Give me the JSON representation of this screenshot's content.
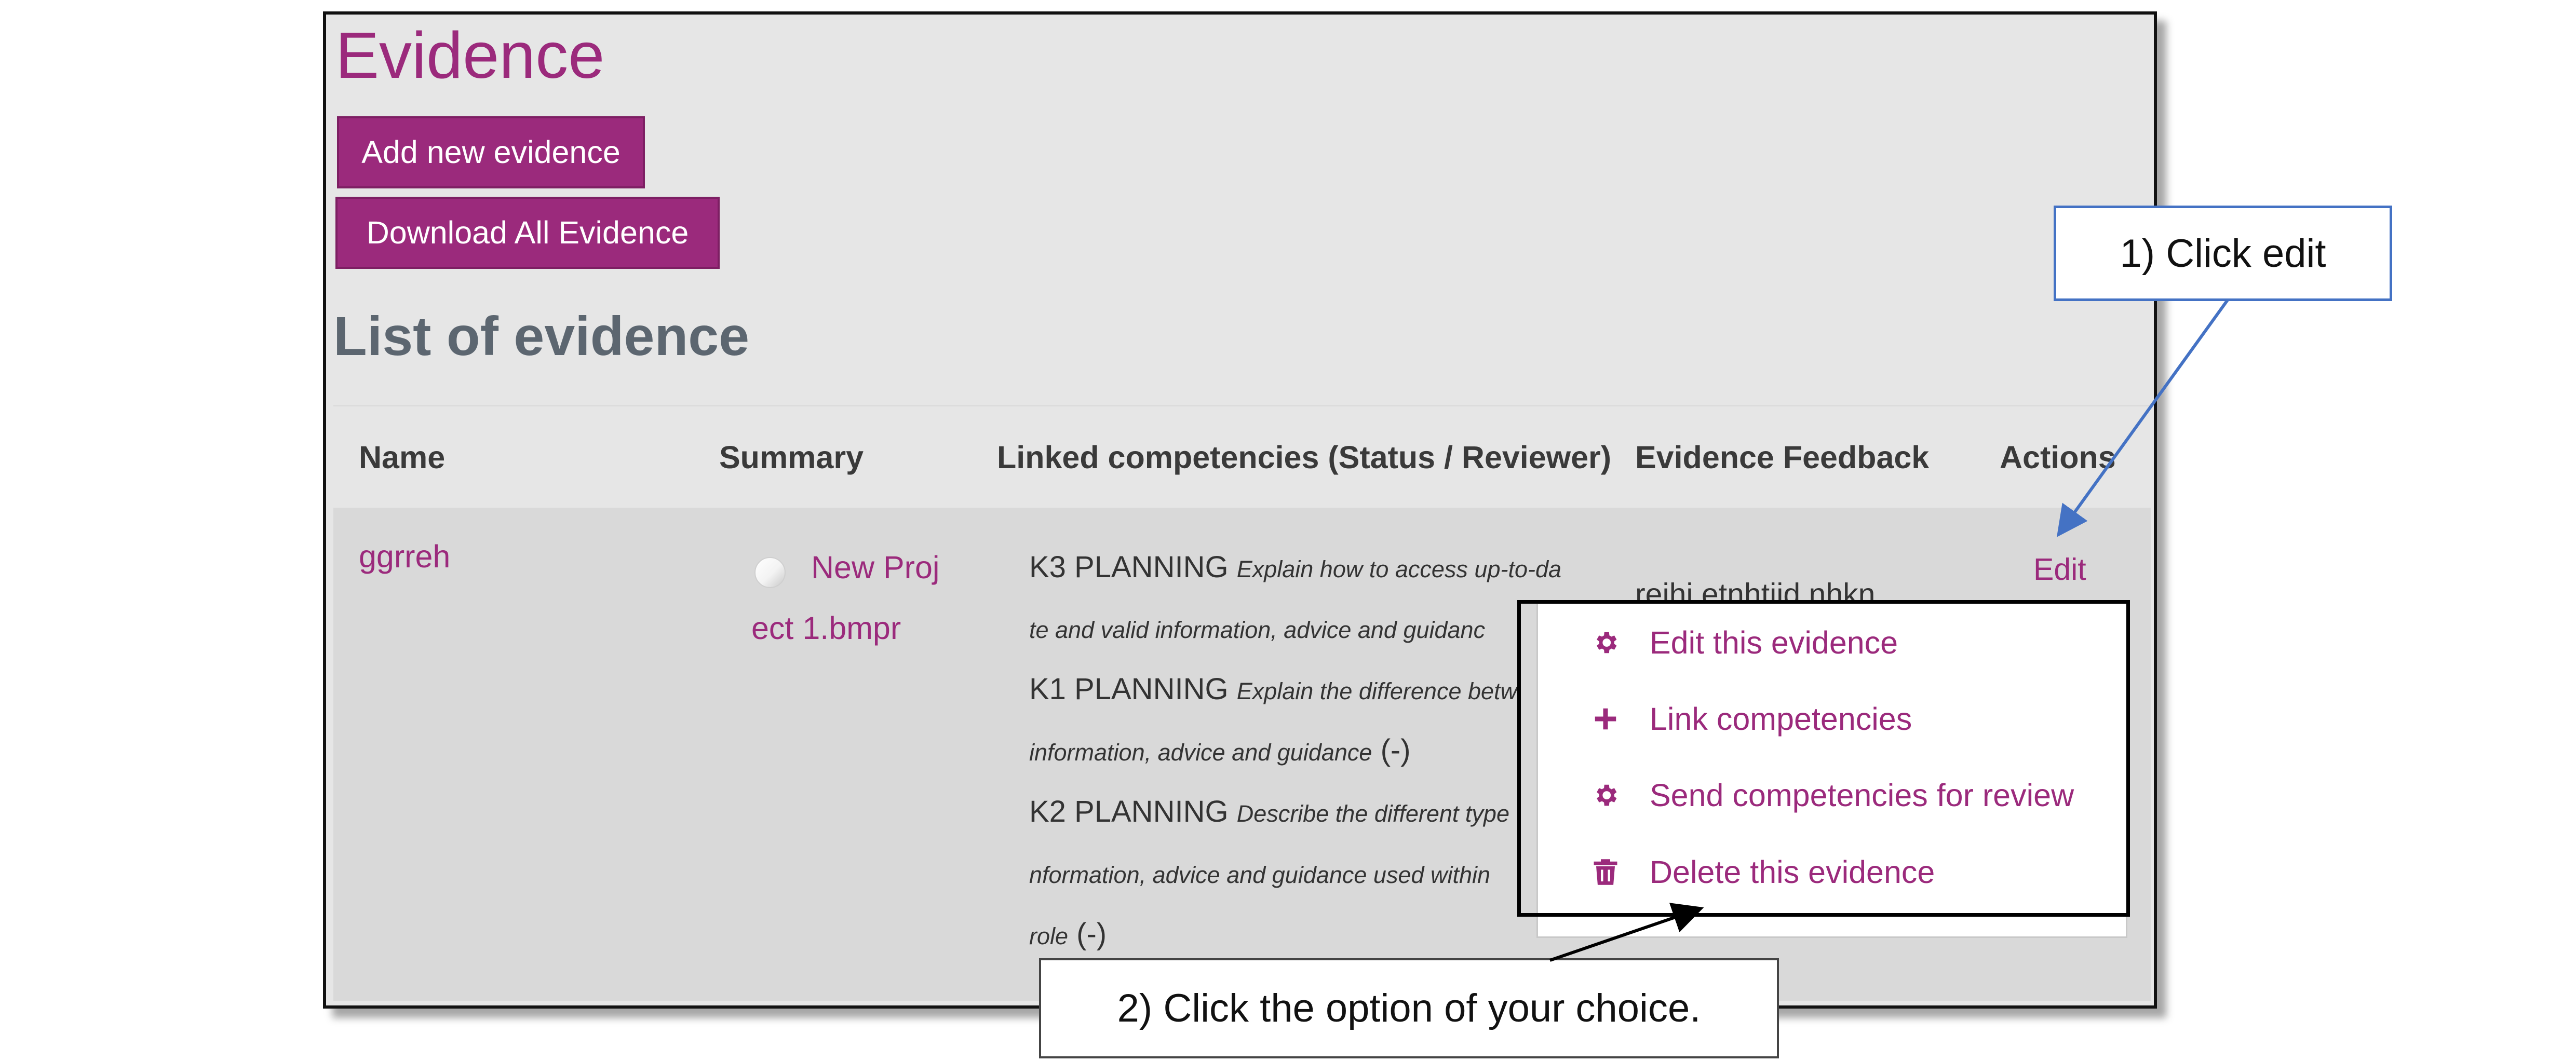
{
  "page": {
    "title": "Evidence",
    "add_button": "Add new evidence",
    "download_button": "Download All Evidence",
    "section_title": "List of evidence"
  },
  "table": {
    "columns": [
      "Name",
      "Summary",
      "Linked competencies (Status / Reviewer)",
      "Evidence Feedback",
      "Actions"
    ],
    "rows": [
      {
        "name": "ggrreh",
        "summary_file_line1": "New Proj",
        "summary_file_line2": "ect 1.bmpr",
        "competency_lines": [
          {
            "code": "K3 PLANNING",
            "text": "Explain how to access up-to-da",
            "status": ""
          },
          {
            "code": "",
            "text": "te and valid information, advice and guidanc",
            "status": ""
          },
          {
            "code": "K1 PLANNING",
            "text": "Explain the difference betw",
            "status": ""
          },
          {
            "code": "",
            "text": "information, advice and guidance",
            "status": "(-)"
          },
          {
            "code": "K2 PLANNING",
            "text": "Describe the different type",
            "status": ""
          },
          {
            "code": "",
            "text": "nformation, advice and guidance used within",
            "status": ""
          },
          {
            "code": "",
            "text": "role",
            "status": "(-)"
          }
        ],
        "feedback": "reihi etnhtiid nhkn",
        "action": "Edit"
      }
    ]
  },
  "dropdown": {
    "items": [
      {
        "label": "Edit this evidence",
        "icon": "gear-icon"
      },
      {
        "label": "Link competencies",
        "icon": "plus-icon"
      },
      {
        "label": "Send competencies for review",
        "icon": "gear-icon"
      },
      {
        "label": "Delete this evidence",
        "icon": "trash-icon"
      }
    ]
  },
  "annotations": {
    "callout_1": "1) Click edit",
    "callout_2": "2) Click the option of your choice."
  },
  "colors": {
    "accent": "#9b2a7c",
    "frame_bg": "#e6e6e6",
    "row_bg": "#d9d9d9",
    "callout_border": "#4472c4",
    "arrow_blue": "#4472c4"
  }
}
